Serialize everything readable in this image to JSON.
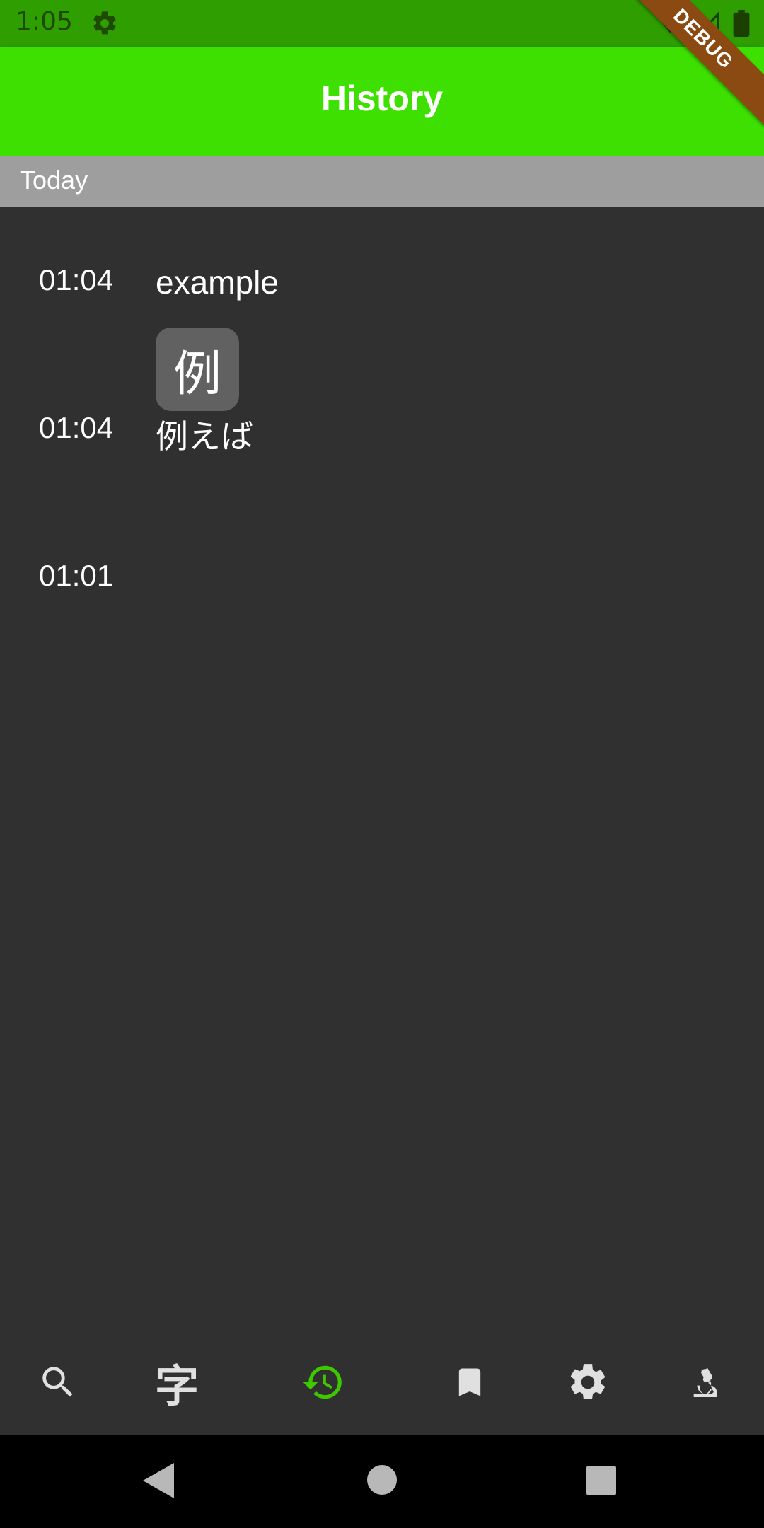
{
  "status_bar": {
    "time": "1:05"
  },
  "app_bar": {
    "title": "History"
  },
  "debug_banner": "DEBUG",
  "section": {
    "label": "Today"
  },
  "history": [
    {
      "time": "01:04",
      "term": "example"
    },
    {
      "time": "01:04",
      "term": "例えば"
    },
    {
      "time": "01:01",
      "kanji": "例"
    }
  ],
  "bottom_nav": [
    {
      "icon": "search-icon",
      "active": false
    },
    {
      "icon": "kanji-icon",
      "label": "字",
      "active": false
    },
    {
      "icon": "history-icon",
      "active": true
    },
    {
      "icon": "bookmark-icon",
      "active": false
    },
    {
      "icon": "settings-icon",
      "active": false
    },
    {
      "icon": "microscope-icon",
      "active": false
    }
  ],
  "colors": {
    "accent": "#3de000",
    "status_bar": "#2e9e00",
    "background": "#303030",
    "section_header": "#9e9e9e",
    "chip": "#616161",
    "debug": "#8b4a12"
  }
}
